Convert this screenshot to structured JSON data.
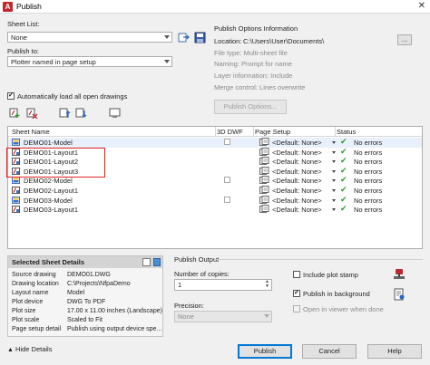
{
  "window": {
    "title": "Publish",
    "close": "✕"
  },
  "sheet_list": {
    "label": "Sheet List:",
    "value": "None"
  },
  "publish_to": {
    "label": "Publish to:",
    "value": "Plotter named in page setup"
  },
  "options_info": {
    "title": "Publish Options Information",
    "location_label": "Location:",
    "location_value": "C:\\Users\\User\\Documents\\",
    "browse": "...",
    "file_type": "File type: Multi-sheet file",
    "naming": "Naming: Prompt for name",
    "layer_info": "Layer information: Include",
    "merge": "Merge control: Lines overwrite",
    "button": "Publish Options..."
  },
  "auto_load": {
    "label": "Automatically load all open drawings",
    "checked": true
  },
  "table": {
    "headers": {
      "name": "Sheet Name",
      "dwf": "3D DWF",
      "setup": "Page Setup",
      "status": "Status"
    },
    "rows": [
      {
        "name": "DEMO01-Model",
        "kind": "model",
        "dwf": true,
        "setup": "<Default: None>",
        "status": "No errors",
        "highlight": true
      },
      {
        "name": "DEMO01-Layout1",
        "kind": "layout",
        "dwf": false,
        "setup": "<Default: None>",
        "status": "No errors"
      },
      {
        "name": "DEMO01-Layout2",
        "kind": "layout",
        "dwf": false,
        "setup": "<Default: None>",
        "status": "No errors"
      },
      {
        "name": "DEMO01-Layout3",
        "kind": "layout",
        "dwf": false,
        "setup": "<Default: None>",
        "status": "No errors"
      },
      {
        "name": "DEMO02-Model",
        "kind": "model",
        "dwf": true,
        "setup": "<Default: None>",
        "status": "No errors"
      },
      {
        "name": "DEMO02-Layout1",
        "kind": "layout",
        "dwf": false,
        "setup": "<Default: None>",
        "status": "No errors"
      },
      {
        "name": "DEMO03-Model",
        "kind": "model",
        "dwf": true,
        "setup": "<Default: None>",
        "status": "No errors"
      },
      {
        "name": "DEMO03-Layout1",
        "kind": "layout",
        "dwf": false,
        "setup": "<Default: None>",
        "status": "No errors"
      }
    ]
  },
  "details": {
    "title": "Selected Sheet Details",
    "rows": [
      {
        "label": "Source drawing",
        "value": "DEMO01.DWG"
      },
      {
        "label": "Drawing location",
        "value": "C:\\Projects\\NfpaDemo"
      },
      {
        "label": "Layout name",
        "value": "Model"
      },
      {
        "label": "Plot device",
        "value": "DWG To PDF"
      },
      {
        "label": "Plot size",
        "value": "17.00 x 11.00 inches (Landscape)"
      },
      {
        "label": "Plot scale",
        "value": "Scaled to Fit"
      },
      {
        "label": "Page setup detail",
        "value": "Publish using output device spe..."
      }
    ]
  },
  "publish_output": {
    "title": "Publish Output",
    "copies_label": "Number of copies:",
    "copies_value": "1",
    "precision_label": "Precision:",
    "precision_value": "None",
    "plot_stamp": {
      "label": "Include plot stamp",
      "checked": false
    },
    "background": {
      "label": "Publish in background",
      "checked": true
    },
    "open_viewer": {
      "label": "Open in viewer when done",
      "checked": false
    }
  },
  "footer": {
    "hide_details": "Hide Details",
    "publish": "Publish",
    "cancel": "Cancel",
    "help": "Help"
  },
  "colors": {
    "accent": "#0078d7",
    "status_ok": "#2e9b2e",
    "selection": "#e02020",
    "autocad_red": "#c1272d"
  }
}
